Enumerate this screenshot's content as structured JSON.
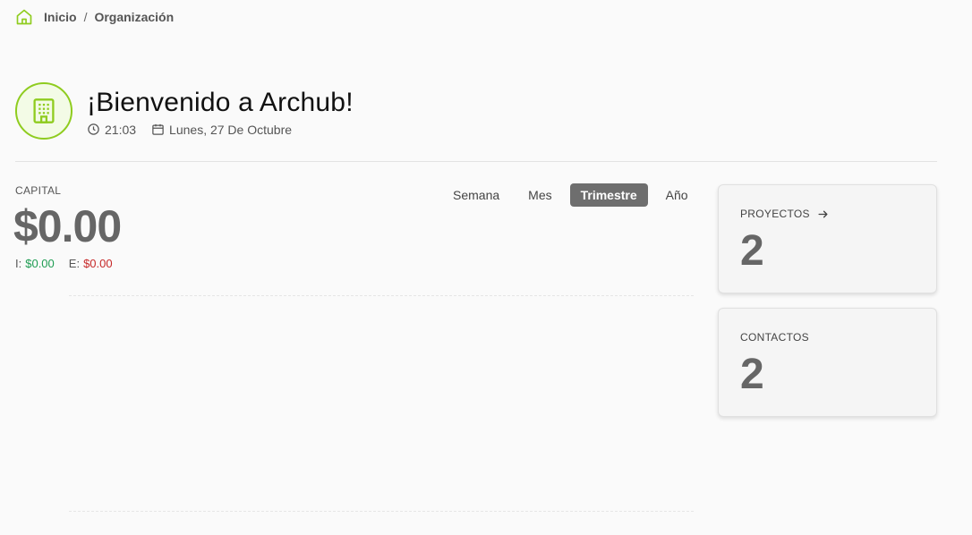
{
  "breadcrumb": {
    "items": [
      {
        "label": "Inicio"
      },
      {
        "label": "Organización"
      }
    ],
    "separator": "/"
  },
  "header": {
    "title": "¡Bienvenido a Archub!",
    "time": "21:03",
    "date": "Lunes, 27 De Octubre",
    "avatar_icon": "building-icon",
    "accent_color": "#8fcc1f"
  },
  "capital": {
    "label": "CAPITAL",
    "value": "$0.00",
    "income_prefix": "I:",
    "income": "$0.00",
    "expense_prefix": "E:",
    "expense": "$0.00",
    "income_color": "#1e9c52",
    "expense_color": "#c62828"
  },
  "periods": {
    "options": [
      "Semana",
      "Mes",
      "Trimestre",
      "Año"
    ],
    "selected": "Trimestre"
  },
  "cards": {
    "projects": {
      "label": "PROYECTOS",
      "count": "2"
    },
    "contacts": {
      "label": "CONTACTOS",
      "count": "2"
    }
  }
}
